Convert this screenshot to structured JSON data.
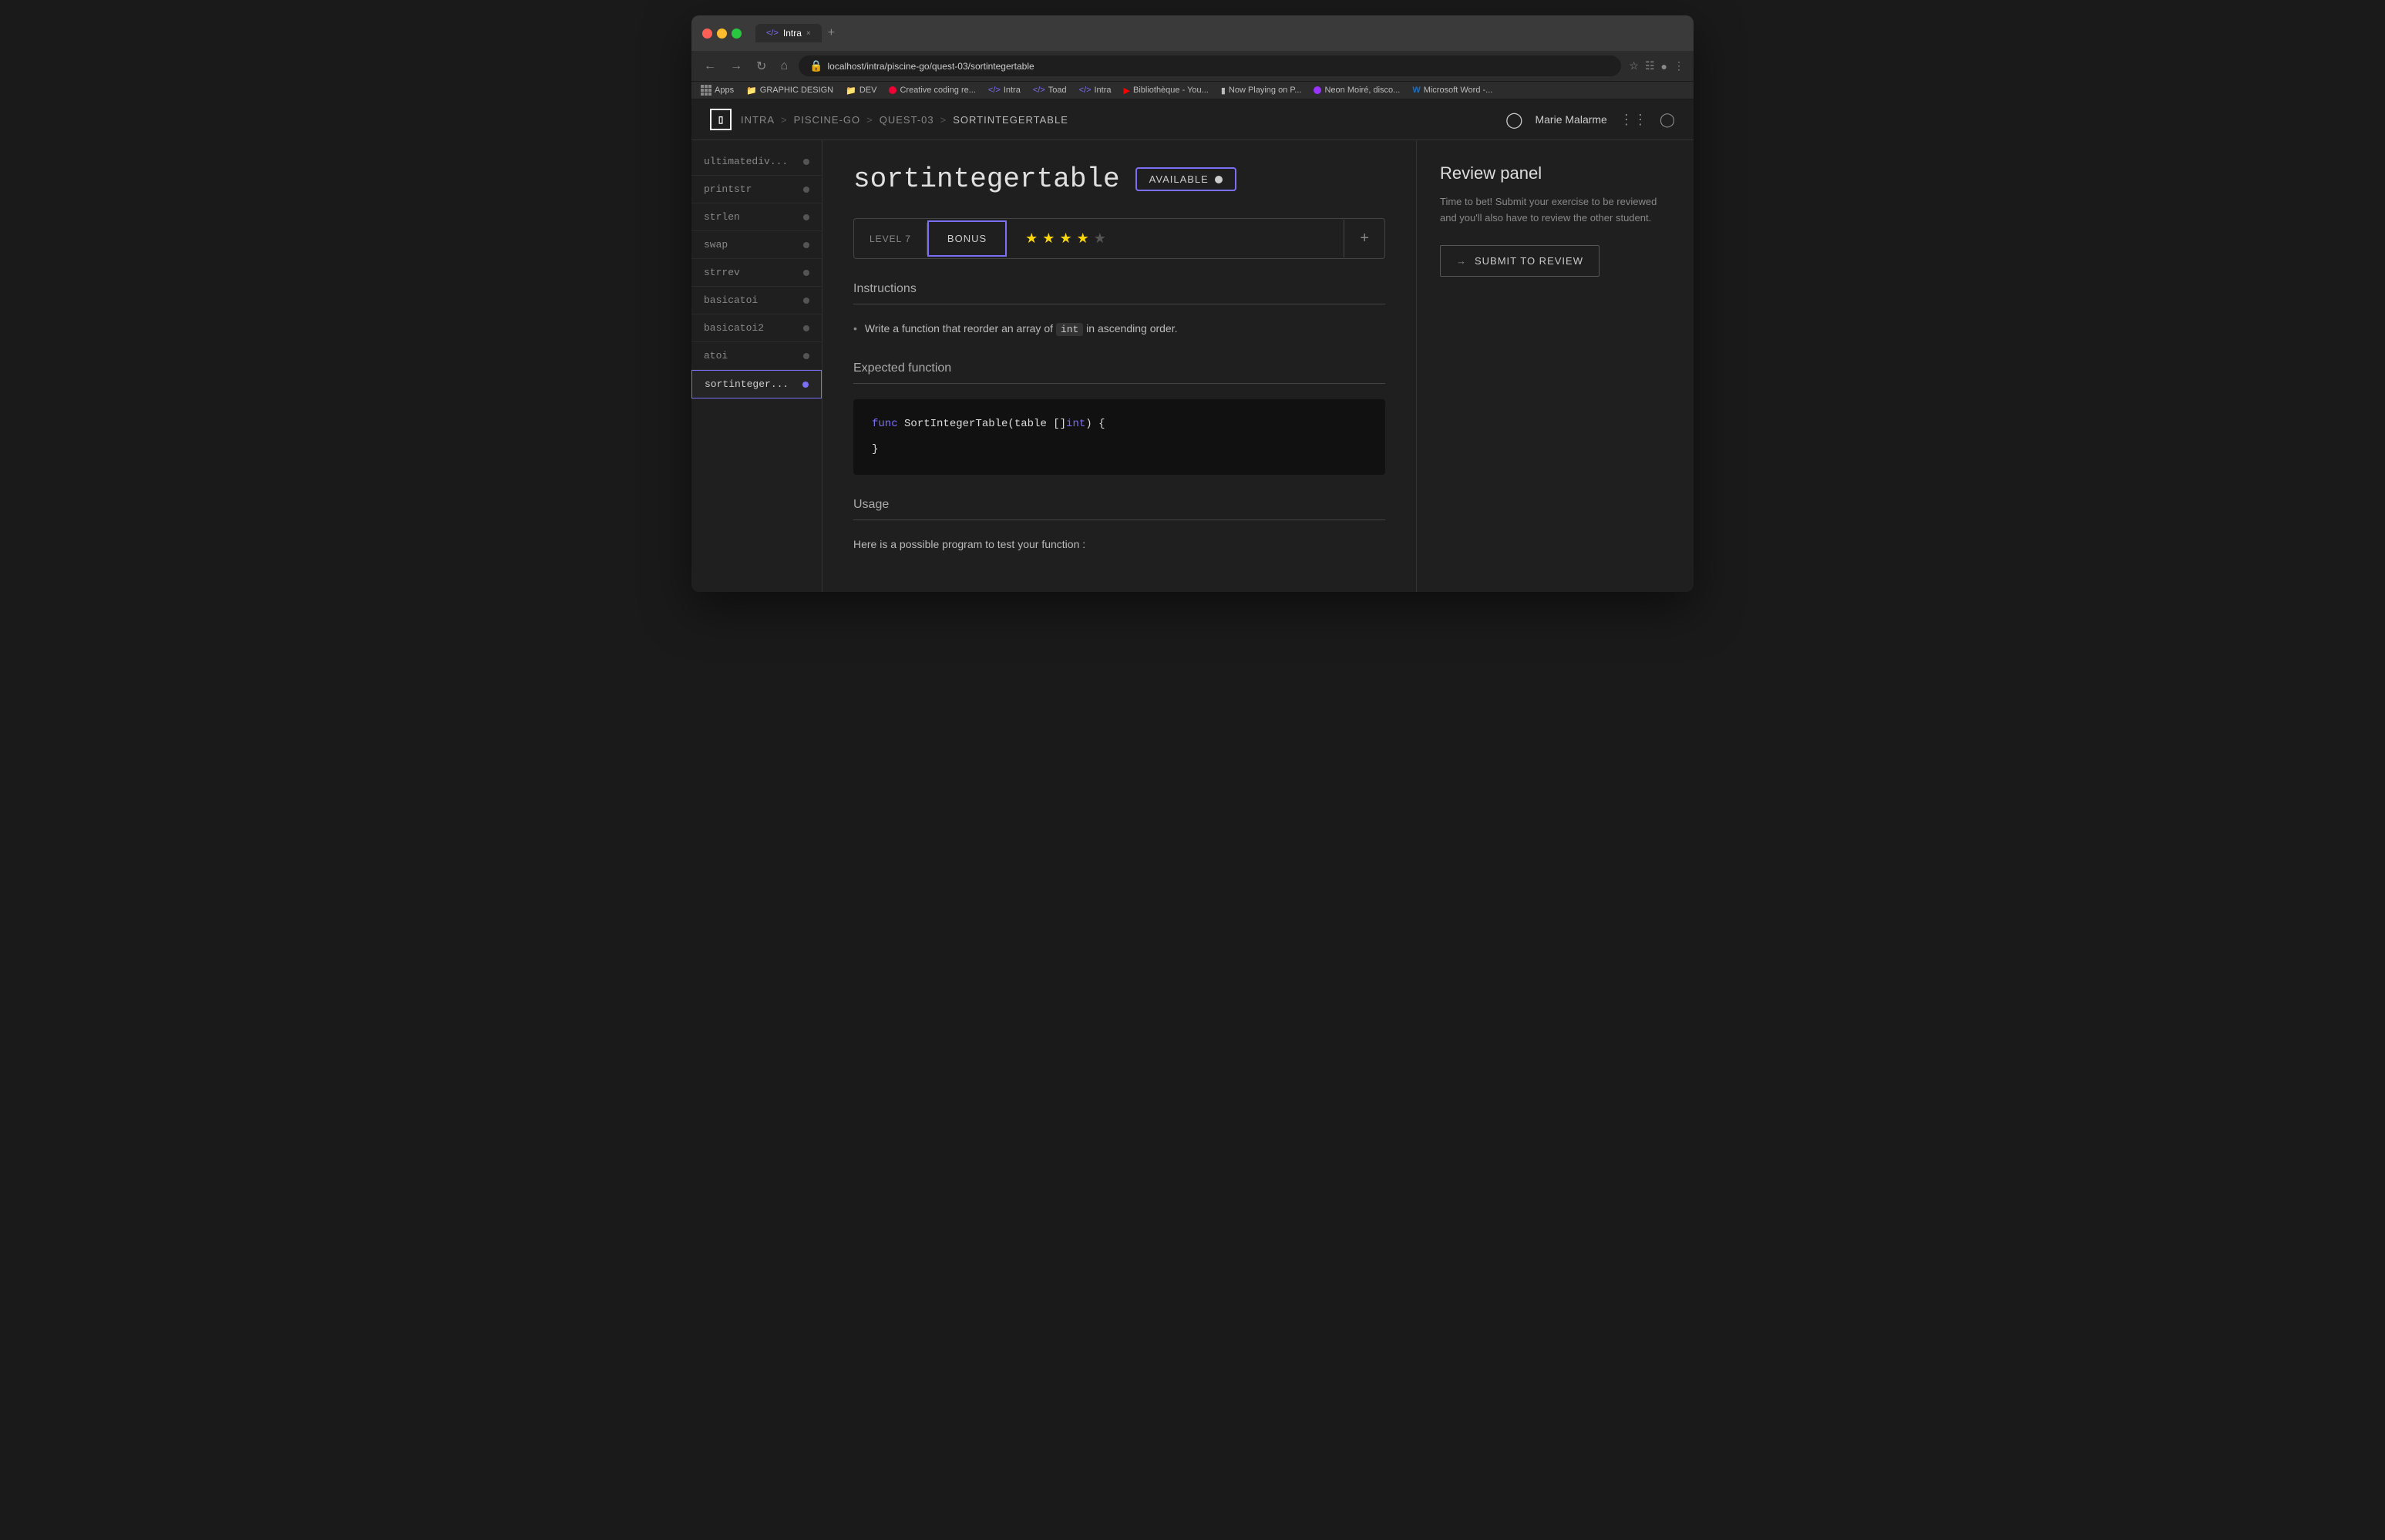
{
  "browser": {
    "tab_icon": "</>",
    "tab_label": "Intra",
    "tab_close": "×",
    "tab_new": "+",
    "address": "localhost/intra/piscine-go/quest-03/sortintegertable",
    "bookmarks": [
      {
        "id": "apps",
        "icon": "grid",
        "label": "Apps"
      },
      {
        "id": "graphic-design",
        "icon": "folder",
        "label": "GRAPHIC DESIGN"
      },
      {
        "id": "dev",
        "icon": "folder",
        "label": "DEV"
      },
      {
        "id": "creative-coding",
        "icon": "red",
        "label": "Creative coding re..."
      },
      {
        "id": "intra1",
        "icon": "code",
        "label": "Intra"
      },
      {
        "id": "toad",
        "icon": "code",
        "label": "Toad"
      },
      {
        "id": "intra2",
        "icon": "code",
        "label": "Intra"
      },
      {
        "id": "bibliotheque",
        "icon": "youtube",
        "label": "Bibliothèque - You..."
      },
      {
        "id": "now-playing",
        "icon": "bookmark",
        "label": "Now Playing on P..."
      },
      {
        "id": "neon-moire",
        "icon": "neon",
        "label": "Neon Moiré, disco..."
      },
      {
        "id": "ms-word",
        "icon": "word",
        "label": "Microsoft Word -..."
      }
    ]
  },
  "nav": {
    "logo_symbol": "◫",
    "breadcrumbs": [
      {
        "label": "INTRA"
      },
      {
        "label": ">"
      },
      {
        "label": "PISCINE-GO"
      },
      {
        "label": ">"
      },
      {
        "label": "QUEST-03"
      },
      {
        "label": ">"
      },
      {
        "label": "SORTINTEGERTABLE"
      }
    ],
    "user_name": "Marie Malarme"
  },
  "sidebar": {
    "items": [
      {
        "label": "ultimatediv...",
        "dot_active": false,
        "active": false
      },
      {
        "label": "printstr",
        "dot_active": false,
        "active": false
      },
      {
        "label": "strlen",
        "dot_active": false,
        "active": false
      },
      {
        "label": "swap",
        "dot_active": false,
        "active": false
      },
      {
        "label": "strrev",
        "dot_active": false,
        "active": false
      },
      {
        "label": "basicatoi",
        "dot_active": false,
        "active": false
      },
      {
        "label": "basicatoi2",
        "dot_active": false,
        "active": false
      },
      {
        "label": "atoi",
        "dot_active": false,
        "active": false
      },
      {
        "label": "sortinteger...",
        "dot_active": true,
        "active": true
      }
    ]
  },
  "main": {
    "page_title": "sortintegertable",
    "available_label": "AVAILABLE",
    "level_label": "LEVEL 7",
    "bonus_label": "BONUS",
    "stars_filled": 4,
    "stars_total": 5,
    "instructions_title": "Instructions",
    "instruction_text_before": "Write a function that reorder an array of ",
    "instruction_code": "int",
    "instruction_text_after": " in ascending order.",
    "expected_function_title": "Expected function",
    "code_line1_kw": "func",
    "code_line1_rest": " SortIntegerTable(table []",
    "code_line1_type": "int",
    "code_line1_end": ") {",
    "code_line2": "}",
    "usage_title": "Usage",
    "usage_desc": "Here is a possible program to test your function :"
  },
  "review_panel": {
    "title": "Review panel",
    "description": "Time to bet! Submit your exercise to be reviewed and you'll also have to review the other student.",
    "submit_arrow": "→",
    "submit_label": "SUBMIT TO REVIEW"
  },
  "colors": {
    "accent": "#7c6ff7",
    "star_filled": "#ffd700",
    "star_empty": "#555"
  }
}
